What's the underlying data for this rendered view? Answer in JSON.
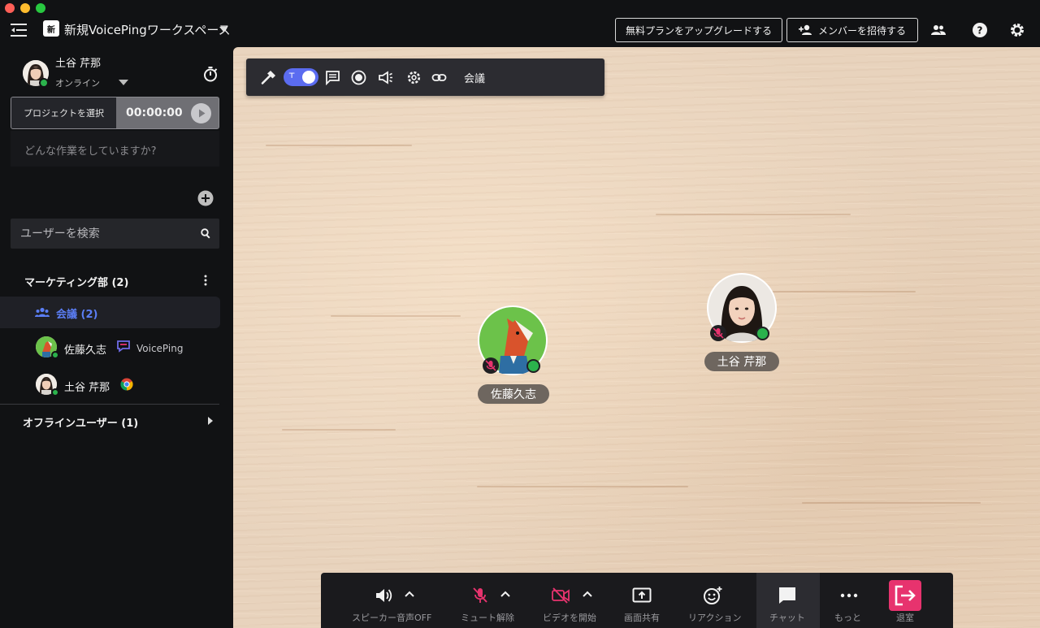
{
  "header": {
    "workspace_logo": "新",
    "workspace_name": "新規VoicePingワークスペース",
    "upgrade_label": "無料プランをアップグレードする",
    "invite_label": "メンバーを招待する",
    "icons": [
      "menu-icon",
      "people-icon",
      "help-icon",
      "gear-icon"
    ]
  },
  "profile": {
    "name": "土谷 芹那",
    "status": "オンライン"
  },
  "timer": {
    "project_select_label": "プロジェクトを選択",
    "time": "00:00:00",
    "task_placeholder": "どんな作業をしていますか?"
  },
  "search": {
    "placeholder": "ユーザーを検索"
  },
  "group": {
    "title": "マーケティング部 (2)",
    "room_label": "会議 (2)",
    "users": [
      {
        "name": "佐藤久志",
        "app": "VoicePing"
      },
      {
        "name": "土谷 芹那",
        "app": ""
      }
    ],
    "offline_label": "オフラインユーザー (1)"
  },
  "canvas": {
    "room_name": "会議",
    "peers": [
      {
        "name": "佐藤久志"
      },
      {
        "name": "土谷 芹那"
      }
    ]
  },
  "controls": {
    "speaker": "スピーカー音声OFF",
    "mute": "ミュート解除",
    "video": "ビデオを開始",
    "share": "画面共有",
    "reaction": "リアクション",
    "chat": "チャット",
    "more": "もっと",
    "leave": "退室"
  },
  "colors": {
    "accent": "#5b6cf0",
    "room_link": "#5b7ef5",
    "online": "#2bb24c",
    "muted_red": "#e7336e",
    "leave_button": "#e7336e"
  }
}
